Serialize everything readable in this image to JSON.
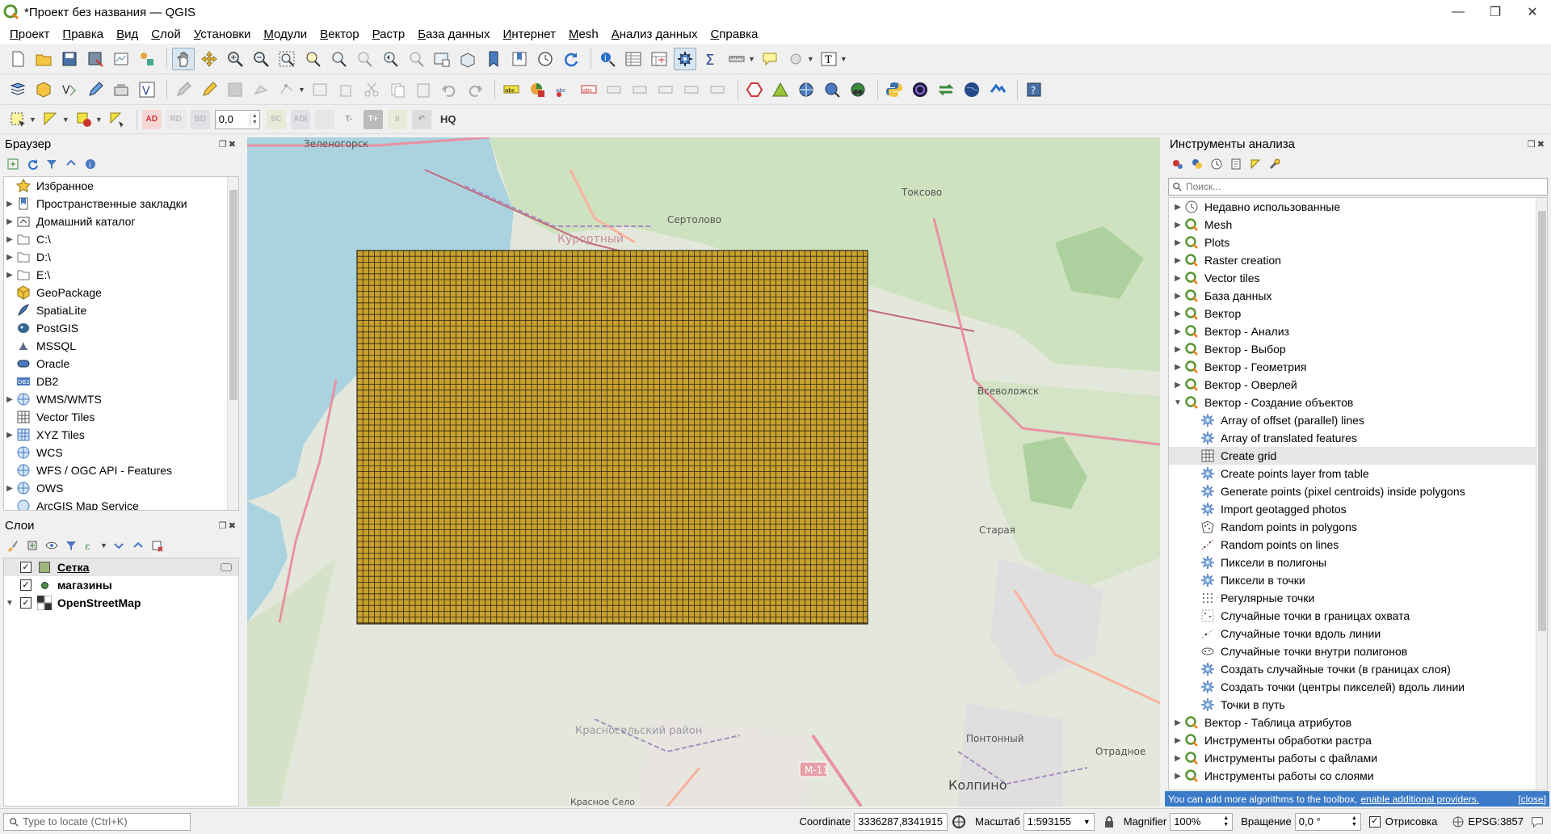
{
  "window": {
    "title": "*Проект без названия — QGIS",
    "minimize": "—",
    "maximize": "❐",
    "close": "✕"
  },
  "menu": [
    "Проект",
    "Правка",
    "Вид",
    "Слой",
    "Установки",
    "Модули",
    "Вектор",
    "Растр",
    "База данных",
    "Интернет",
    "Mesh",
    "Анализ данных",
    "Справка"
  ],
  "toolbar3": {
    "rotation_value": "0,0",
    "label_ad": "AD",
    "label_rd": "RD",
    "label_bd": "BD",
    "label_sc": "SC",
    "label_adi": "ADI",
    "label_hq": "HQ"
  },
  "browser": {
    "title": "Браузер",
    "items": [
      {
        "label": "Избранное",
        "icon": "star-icon",
        "expandable": false
      },
      {
        "label": "Пространственные закладки",
        "icon": "bookmark-icon",
        "expandable": true
      },
      {
        "label": "Домашний каталог",
        "icon": "home-folder-icon",
        "expandable": true
      },
      {
        "label": "C:\\",
        "icon": "folder-icon",
        "expandable": true
      },
      {
        "label": "D:\\",
        "icon": "folder-icon",
        "expandable": true
      },
      {
        "label": "E:\\",
        "icon": "folder-icon",
        "expandable": true
      },
      {
        "label": "GeoPackage",
        "icon": "geopackage-icon",
        "expandable": false
      },
      {
        "label": "SpatiaLite",
        "icon": "spatialite-icon",
        "expandable": false
      },
      {
        "label": "PostGIS",
        "icon": "postgis-icon",
        "expandable": false
      },
      {
        "label": "MSSQL",
        "icon": "mssql-icon",
        "expandable": false
      },
      {
        "label": "Oracle",
        "icon": "oracle-icon",
        "expandable": false
      },
      {
        "label": "DB2",
        "icon": "db2-icon",
        "expandable": false
      },
      {
        "label": "WMS/WMTS",
        "icon": "wms-icon",
        "expandable": true
      },
      {
        "label": "Vector Tiles",
        "icon": "vector-tiles-icon",
        "expandable": false
      },
      {
        "label": "XYZ Tiles",
        "icon": "xyz-tiles-icon",
        "expandable": true
      },
      {
        "label": "WCS",
        "icon": "wcs-icon",
        "expandable": false
      },
      {
        "label": "WFS / OGC API - Features",
        "icon": "wfs-icon",
        "expandable": false
      },
      {
        "label": "OWS",
        "icon": "ows-icon",
        "expandable": true
      },
      {
        "label": "ArcGIS Map Service",
        "icon": "arcgis-icon",
        "expandable": false
      }
    ]
  },
  "layers": {
    "title": "Слои",
    "items": [
      {
        "label": "Сетка",
        "checked": true,
        "symbol": "polygon",
        "color": "#9bb57a",
        "bold": true,
        "underline": true
      },
      {
        "label": "магазины",
        "checked": true,
        "symbol": "point",
        "color": "#4a8f3a",
        "bold": true,
        "underline": false
      },
      {
        "label": "OpenStreetMap",
        "checked": true,
        "symbol": "raster",
        "color": "#333333",
        "bold": true,
        "underline": false
      }
    ]
  },
  "map": {
    "grid_fill": "#c9a22e",
    "grid_stroke": "#2a2418",
    "labels": [
      "Зеленогорск",
      "Токсово",
      "Сертолово",
      "Курортный",
      "Всеволожск",
      "Старая",
      "Красносельский район",
      "Понтонный",
      "Отрадное",
      "М-11",
      "Колпино",
      "Красное Село"
    ]
  },
  "processing": {
    "title": "Инструменты анализа",
    "search_placeholder": "Поиск...",
    "groups_top": [
      {
        "label": "Недавно использованные",
        "icon": "clock-icon"
      },
      {
        "label": "Mesh",
        "icon": "qgis-icon"
      },
      {
        "label": "Plots",
        "icon": "qgis-icon"
      },
      {
        "label": "Raster creation",
        "icon": "qgis-icon"
      },
      {
        "label": "Vector tiles",
        "icon": "qgis-icon"
      },
      {
        "label": "База данных",
        "icon": "qgis-icon"
      },
      {
        "label": "Вектор",
        "icon": "qgis-icon"
      },
      {
        "label": "Вектор - Анализ",
        "icon": "qgis-icon"
      },
      {
        "label": "Вектор - Выбор",
        "icon": "qgis-icon"
      },
      {
        "label": "Вектор - Геометрия",
        "icon": "qgis-icon"
      },
      {
        "label": "Вектор - Оверлей",
        "icon": "qgis-icon"
      },
      {
        "label": "Вектор - Создание объектов",
        "icon": "qgis-icon",
        "expanded": true
      }
    ],
    "children": [
      {
        "label": "Array of offset (parallel) lines",
        "icon": "gear-icon"
      },
      {
        "label": "Array of translated features",
        "icon": "gear-icon"
      },
      {
        "label": "Create grid",
        "icon": "grid-icon",
        "selected": true
      },
      {
        "label": "Create points layer from table",
        "icon": "gear-icon"
      },
      {
        "label": "Generate points (pixel centroids) inside polygons",
        "icon": "gear-icon"
      },
      {
        "label": "Import geotagged photos",
        "icon": "gear-icon"
      },
      {
        "label": "Random points in polygons",
        "icon": "random-polygon-icon"
      },
      {
        "label": "Random points on lines",
        "icon": "random-lines-icon"
      },
      {
        "label": "Пиксели в полигоны",
        "icon": "gear-icon"
      },
      {
        "label": "Пиксели в точки",
        "icon": "gear-icon"
      },
      {
        "label": "Регулярные точки",
        "icon": "regular-points-icon"
      },
      {
        "label": "Случайные точки в границах охвата",
        "icon": "random-extent-icon"
      },
      {
        "label": "Случайные точки вдоль линии",
        "icon": "random-along-line-icon"
      },
      {
        "label": "Случайные точки внутри полигонов",
        "icon": "random-in-polygons-icon"
      },
      {
        "label": "Создать случайные точки (в границах слоя)",
        "icon": "gear-icon"
      },
      {
        "label": "Создать точки (центры пикселей) вдоль линии",
        "icon": "gear-icon"
      },
      {
        "label": "Точки в путь",
        "icon": "gear-icon"
      }
    ],
    "groups_bottom": [
      {
        "label": "Вектор - Таблица атрибутов",
        "icon": "qgis-icon"
      },
      {
        "label": "Инструменты обработки растра",
        "icon": "qgis-icon"
      },
      {
        "label": "Инструменты работы с файлами",
        "icon": "qgis-icon"
      },
      {
        "label": "Инструменты работы со слоями",
        "icon": "qgis-icon"
      }
    ],
    "notice_text": "You can add more algorithms to the toolbox,",
    "notice_link": "enable additional providers.",
    "notice_close": "[close]"
  },
  "status": {
    "locate_placeholder": "Type to locate (Ctrl+K)",
    "coordinate_label": "Coordinate",
    "coordinate_value": "3336287,8341915",
    "scale_label": "Масштаб",
    "scale_value": "1:593155",
    "magnifier_label": "Magnifier",
    "magnifier_value": "100%",
    "rotation_label": "Вращение",
    "rotation_value": "0,0 °",
    "render_label": "Отрисовка",
    "crs_label": "EPSG:3857"
  }
}
